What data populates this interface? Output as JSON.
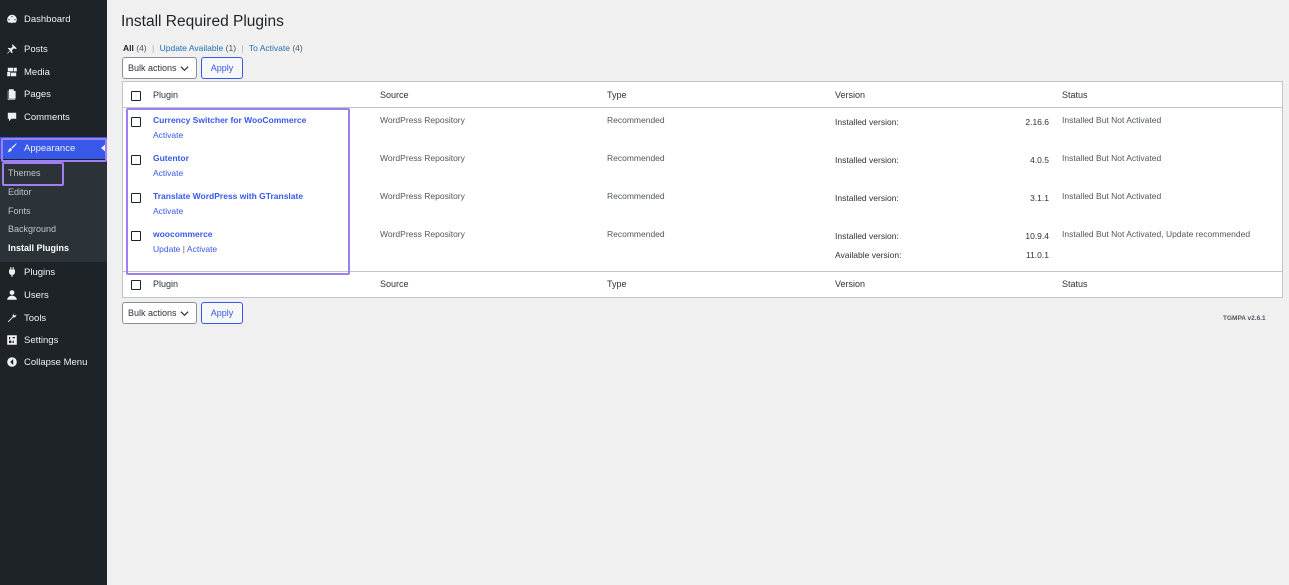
{
  "sidebar": {
    "items": [
      {
        "label": "Dashboard",
        "icon": "dashboard-icon"
      },
      {
        "label": "Posts",
        "icon": "pushpin-icon"
      },
      {
        "label": "Media",
        "icon": "media-icon"
      },
      {
        "label": "Pages",
        "icon": "pages-icon"
      },
      {
        "label": "Comments",
        "icon": "comment-icon"
      },
      {
        "label": "Appearance",
        "icon": "paintbrush-icon"
      },
      {
        "label": "Plugins",
        "icon": "plug-icon"
      },
      {
        "label": "Users",
        "icon": "user-icon"
      },
      {
        "label": "Tools",
        "icon": "wrench-icon"
      },
      {
        "label": "Settings",
        "icon": "settings-icon"
      },
      {
        "label": "Collapse Menu",
        "icon": "collapse-icon"
      }
    ],
    "submenu": [
      "Themes",
      "Editor",
      "Fonts",
      "Background",
      "Install Plugins"
    ]
  },
  "page": {
    "title": "Install Required Plugins",
    "filters": {
      "all_label": "All",
      "all_count": "(4)",
      "update_label": "Update Available",
      "update_count": "(1)",
      "activate_label": "To Activate",
      "activate_count": "(4)",
      "separator": "|"
    },
    "bulk_actions_label": "Bulk actions",
    "apply_label": "Apply",
    "footer_version": "TGMPA v2.6.1"
  },
  "table": {
    "columns": [
      "Plugin",
      "Source",
      "Type",
      "Version",
      "Status"
    ],
    "rows": [
      {
        "name": "Currency Switcher for WooCommerce",
        "actions": [
          "Activate"
        ],
        "source": "WordPress Repository",
        "type": "Recommended",
        "installed_label": "Installed version:",
        "installed_version": "2.16.6",
        "status": "Installed But Not Activated"
      },
      {
        "name": "Gutentor",
        "actions": [
          "Activate"
        ],
        "source": "WordPress Repository",
        "type": "Recommended",
        "installed_label": "Installed version:",
        "installed_version": "4.0.5",
        "status": "Installed But Not Activated"
      },
      {
        "name": "Translate WordPress with GTranslate",
        "actions": [
          "Activate"
        ],
        "source": "WordPress Repository",
        "type": "Recommended",
        "installed_label": "Installed version:",
        "installed_version": "3.1.1",
        "status": "Installed But Not Activated"
      },
      {
        "name": "woocommerce",
        "actions": [
          "Update",
          "Activate"
        ],
        "action_separator": "|",
        "source": "WordPress Repository",
        "type": "Recommended",
        "installed_label": "Installed version:",
        "installed_version": "10.9.4",
        "available_label": "Available version:",
        "available_version": "11.0.1",
        "status": "Installed But Not Activated, Update recommended"
      }
    ]
  },
  "colors": {
    "sidebar_bg": "#1d2327",
    "accent": "#3858e9",
    "highlight": "#9e7ff0"
  }
}
